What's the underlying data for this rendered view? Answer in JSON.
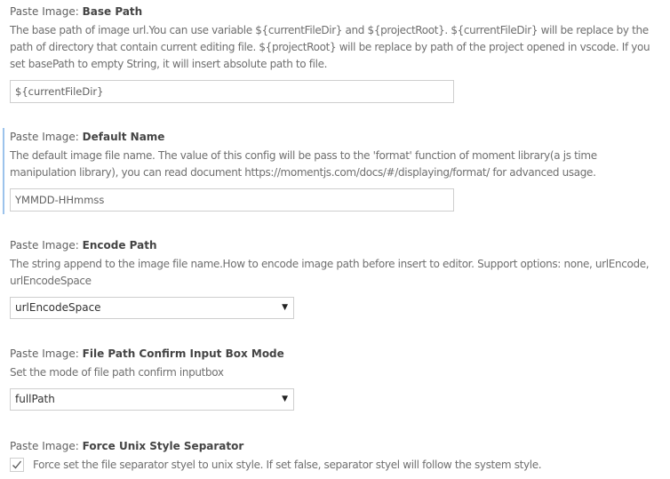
{
  "settings": [
    {
      "category": "Paste Image: ",
      "label": "Base Path",
      "description": "The base path of image url.You can use variable ${currentFileDir} and ${projectRoot}. ${currentFileDir} will be replace by the path of directory that contain current editing file. ${projectRoot} will be replace by path of the project opened in vscode. If you set basePath to empty String, it will insert absolute path to file.",
      "value": "${currentFileDir}"
    },
    {
      "category": "Paste Image: ",
      "label": "Default Name",
      "description": "The default image file name. The value of this config will be pass to the 'format' function of moment library(a js time manipulation library), you can read document https://momentjs.com/docs/#/displaying/format/ for advanced usage.",
      "value": "YMMDD-HHmmss"
    },
    {
      "category": "Paste Image: ",
      "label": "Encode Path",
      "description": "The string append to the image file name.How to encode image path before insert to editor. Support options: none, urlEncode, urlEncodeSpace",
      "value": "urlEncodeSpace"
    },
    {
      "category": "Paste Image: ",
      "label": "File Path Confirm Input Box Mode",
      "description": "Set the mode of file path confirm inputbox",
      "value": "fullPath"
    },
    {
      "category": "Paste Image: ",
      "label": "Force Unix Style Separator",
      "description": "Force set the file separator styel to unix style. If set false, separator styel will follow the system style.",
      "checked": true
    }
  ],
  "icons": {
    "dropdown": "▼",
    "checkmark": "check-icon"
  }
}
